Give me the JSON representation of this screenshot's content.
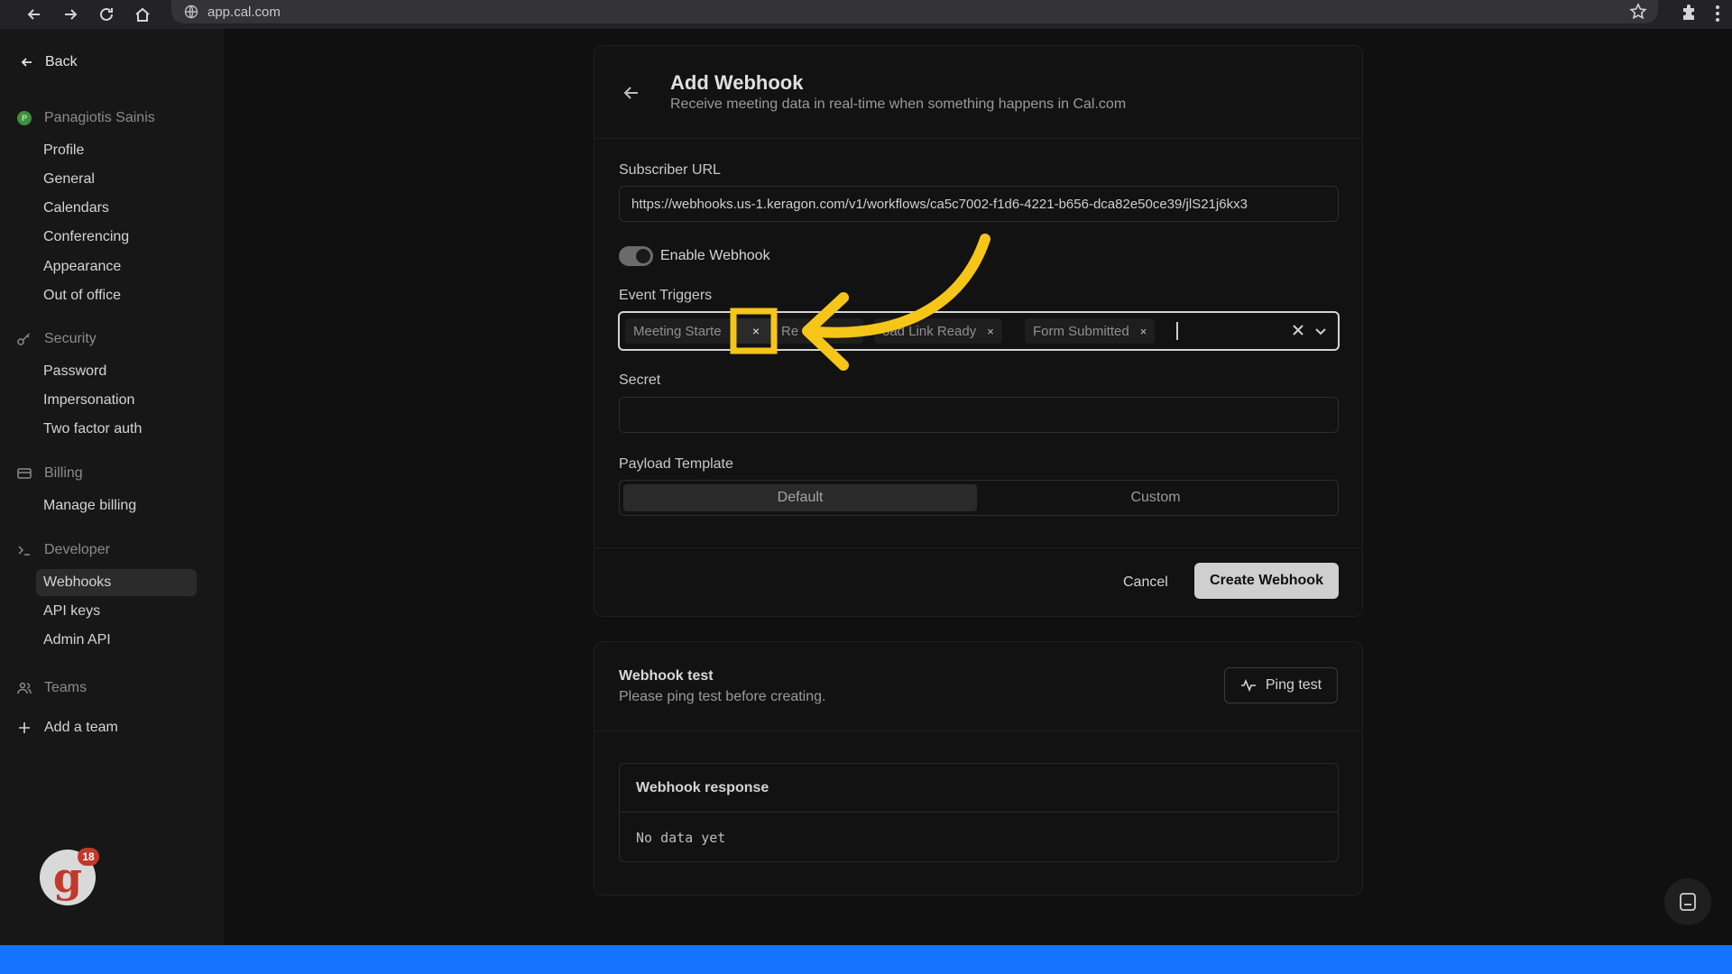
{
  "browser": {
    "url": "app.cal.com"
  },
  "sidebar": {
    "back_label": "Back",
    "user": {
      "initial": "P",
      "name": "Panagiotis Sainis"
    },
    "profile_items": [
      "Profile",
      "General",
      "Calendars",
      "Conferencing",
      "Appearance",
      "Out of office"
    ],
    "security": {
      "label": "Security",
      "items": [
        "Password",
        "Impersonation",
        "Two factor auth"
      ]
    },
    "billing": {
      "label": "Billing",
      "items": [
        "Manage billing"
      ]
    },
    "developer": {
      "label": "Developer",
      "items": [
        "Webhooks",
        "API keys",
        "Admin API"
      ],
      "active": "Webhooks"
    },
    "teams": {
      "label": "Teams"
    },
    "add_team": "Add a team",
    "notification_count": "18"
  },
  "webhook_form": {
    "title": "Add Webhook",
    "subtitle": "Receive meeting data in real-time when something happens in Cal.com",
    "subscriber_url_label": "Subscriber URL",
    "subscriber_url_value": "https://webhooks.us-1.keragon.com/v1/workflows/ca5c7002-f1d6-4221-b656-dca82e50ce39/jlS21j6kx3",
    "enable_label": "Enable Webhook",
    "enabled": true,
    "event_triggers_label": "Event Triggers",
    "event_triggers": [
      "Meeting Starte",
      "Re",
      "oad Link Ready",
      "Form Submitted"
    ],
    "secret_label": "Secret",
    "secret_value": "",
    "payload_label": "Payload Template",
    "payload_options": [
      "Default",
      "Custom"
    ],
    "payload_selected": "Default",
    "cancel_label": "Cancel",
    "create_label": "Create Webhook"
  },
  "webhook_test": {
    "title": "Webhook test",
    "subtitle": "Please ping test before creating.",
    "ping_label": "Ping test",
    "response_title": "Webhook response",
    "response_body": "No data yet"
  },
  "colors": {
    "highlight": "#F5C518",
    "accent": "#1573FF",
    "background": "#101010"
  }
}
